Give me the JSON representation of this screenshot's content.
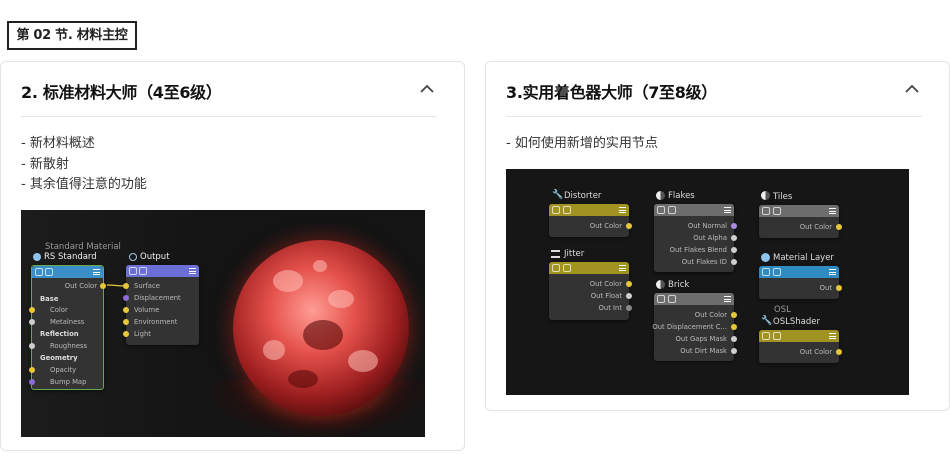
{
  "section_tag": "第 02 节. 材料主控",
  "cards": [
    {
      "title": "2. 标准材料大师（4至6级）",
      "bullets": [
        "新材料概述",
        "新散射",
        "其余值得注意的功能"
      ],
      "screenshot": {
        "standard_material": {
          "caption": "Standard Material",
          "title": "RS Standard",
          "out": "Out Color",
          "rows": [
            {
              "kind": "section",
              "label": "Base"
            },
            {
              "kind": "port",
              "label": "Color",
              "dot": "#e8c63a"
            },
            {
              "kind": "port",
              "label": "Metalness",
              "dot": "#cfcfcf"
            },
            {
              "kind": "section",
              "label": "Reflection"
            },
            {
              "kind": "port",
              "label": "Roughness",
              "dot": "#cfcfcf"
            },
            {
              "kind": "section",
              "label": "Geometry"
            },
            {
              "kind": "port",
              "label": "Opacity",
              "dot": "#e8c63a"
            },
            {
              "kind": "port",
              "label": "Bump Map",
              "dot": "#8f6ad9"
            }
          ]
        },
        "output_node": {
          "title": "Output",
          "rows": [
            {
              "label": "Surface",
              "dot": "#e8c63a"
            },
            {
              "label": "Displacement",
              "dot": "#8f6ad9"
            },
            {
              "label": "Volume",
              "dot": "#e8c63a"
            },
            {
              "label": "Environment",
              "dot": "#e8c63a"
            },
            {
              "label": "Light",
              "dot": "#e8c63a"
            }
          ]
        }
      }
    },
    {
      "title": "3.实用着色器大师（7至8级）",
      "bullets": [
        "如何使用新增的实用节点"
      ],
      "screenshot": {
        "distorter": {
          "title": "Distorter",
          "ports": [
            {
              "label": "Out Color",
              "dot": "#e8c63a"
            }
          ]
        },
        "jitter": {
          "title": "Jitter",
          "ports": [
            {
              "label": "Out Color",
              "dot": "#e8c63a"
            },
            {
              "label": "Out Float",
              "dot": "#cfcfcf"
            },
            {
              "label": "Out Int",
              "dot": "#888888"
            }
          ]
        },
        "flakes": {
          "title": "Flakes",
          "ports": [
            {
              "label": "Out Normal",
              "dot": "#a98ae0"
            },
            {
              "label": "Out Alpha",
              "dot": "#cfcfcf"
            },
            {
              "label": "Out Flakes Blend",
              "dot": "#cfcfcf"
            },
            {
              "label": "Out Flakes ID",
              "dot": "#cfcfcf"
            }
          ]
        },
        "brick": {
          "title": "Brick",
          "ports": [
            {
              "label": "Out Color",
              "dot": "#e8c63a"
            },
            {
              "label": "Out Displacement C...",
              "dot": "#e8c63a"
            },
            {
              "label": "Out Gaps Mask",
              "dot": "#cfcfcf"
            },
            {
              "label": "Out Dirt Mask",
              "dot": "#cfcfcf"
            }
          ]
        },
        "tiles": {
          "title": "Tiles",
          "ports": [
            {
              "label": "Out Color",
              "dot": "#e8c63a"
            }
          ]
        },
        "material_layer": {
          "title": "Material Layer",
          "ports": [
            {
              "label": "Out",
              "dot": "#e8c63a"
            }
          ]
        },
        "osl": {
          "caption": "OSL",
          "title": "OSLShader",
          "ports": [
            {
              "label": "Out Color",
              "dot": "#e8c63a"
            }
          ]
        }
      }
    }
  ],
  "colors": {
    "bar_blue": "#3b8fc8",
    "bar_purple": "#6b6fd6",
    "bar_olive": "#a09321",
    "bar_gray": "#6d6d6d",
    "bar_cyan": "#2e8cc0",
    "wire_yellow": "#e8c63a"
  }
}
